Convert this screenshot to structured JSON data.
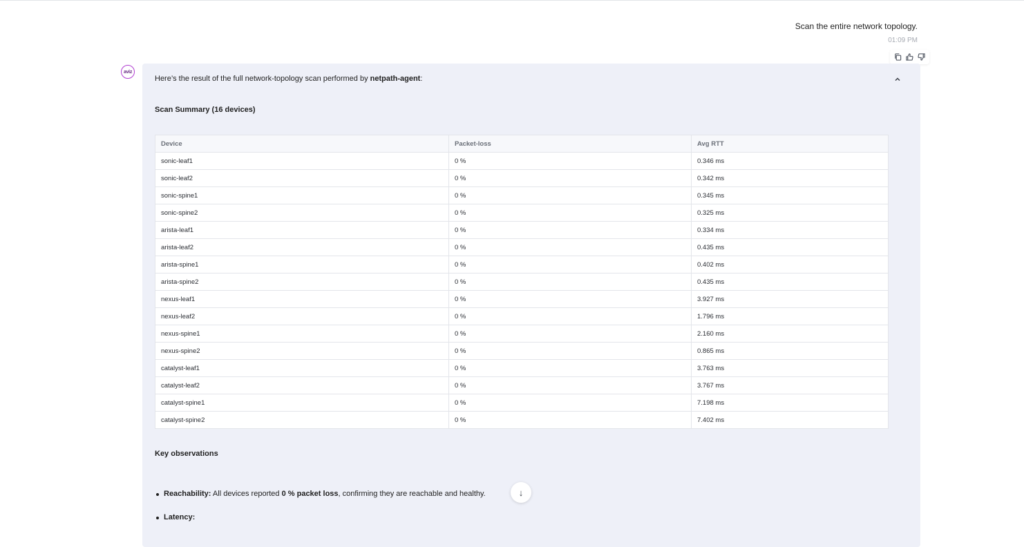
{
  "user_message": {
    "text": "Scan the entire network topology.",
    "time": "01:09 PM"
  },
  "message_actions": {
    "copy_icon": "copy-icon",
    "like_icon": "thumbs-up-icon",
    "dislike_icon": "thumbs-down-icon"
  },
  "avatar": {
    "text": "aviz"
  },
  "bot_message": {
    "intro_prefix": "Here’s the result of the full network-topology scan performed by ",
    "intro_agent": "netpath-agent",
    "intro_suffix": ":",
    "summary_title": "Scan Summary (16 devices)",
    "table": {
      "headers": [
        "Device",
        "Packet-loss",
        "Avg RTT"
      ],
      "rows": [
        [
          "sonic-leaf1",
          "0 %",
          "0.346 ms"
        ],
        [
          "sonic-leaf2",
          "0 %",
          "0.342 ms"
        ],
        [
          "sonic-spine1",
          "0 %",
          "0.345 ms"
        ],
        [
          "sonic-spine2",
          "0 %",
          "0.325 ms"
        ],
        [
          "arista-leaf1",
          "0 %",
          "0.334 ms"
        ],
        [
          "arista-leaf2",
          "0 %",
          "0.435 ms"
        ],
        [
          "arista-spine1",
          "0 %",
          "0.402 ms"
        ],
        [
          "arista-spine2",
          "0 %",
          "0.435 ms"
        ],
        [
          "nexus-leaf1",
          "0 %",
          "3.927 ms"
        ],
        [
          "nexus-leaf2",
          "0 %",
          "1.796 ms"
        ],
        [
          "nexus-spine1",
          "0 %",
          "2.160 ms"
        ],
        [
          "nexus-spine2",
          "0 %",
          "0.865 ms"
        ],
        [
          "catalyst-leaf1",
          "0 %",
          "3.763 ms"
        ],
        [
          "catalyst-leaf2",
          "0 %",
          "3.767 ms"
        ],
        [
          "catalyst-spine1",
          "0 %",
          "7.198 ms"
        ],
        [
          "catalyst-spine2",
          "0 %",
          "7.402 ms"
        ]
      ]
    },
    "observations_title": "Key observations",
    "observations": [
      {
        "label": "Reachability:",
        "text_before": " All devices reported ",
        "bold": "0 % packet loss",
        "text_after": ", confirming they are reachable and healthy."
      },
      {
        "label": "Latency:",
        "text_before": "",
        "bold": "",
        "text_after": ""
      }
    ]
  },
  "scroll_down": {
    "glyph": "↓"
  }
}
